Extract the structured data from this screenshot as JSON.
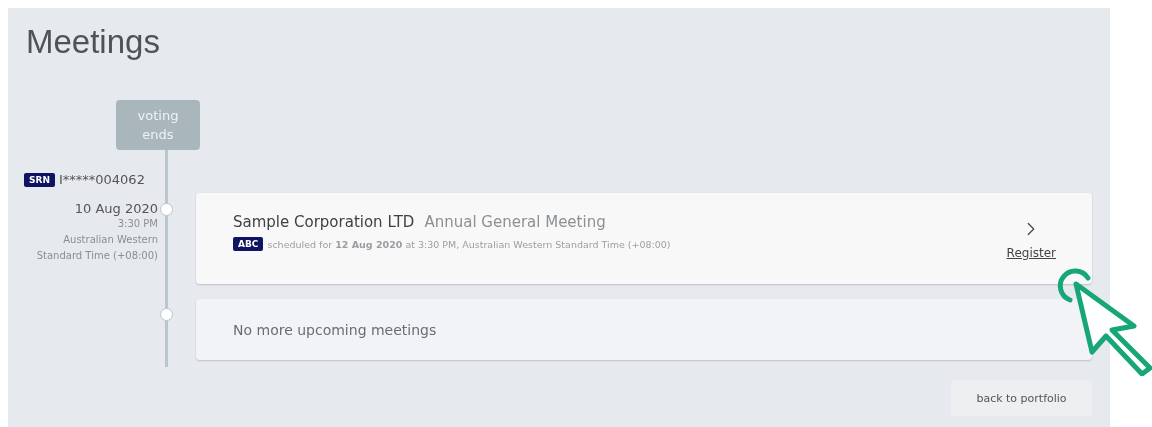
{
  "page": {
    "title": "Meetings"
  },
  "timeline": {
    "marker": "voting\nends",
    "account": {
      "badge": "SRN",
      "number": "I*****004062"
    },
    "meetings": [
      {
        "date": "10 Aug 2020",
        "time": "3:30 PM",
        "timezone": "Australian Western Standard Time (+08:00)",
        "company": "Sample Corporation LTD",
        "type": "Annual General Meeting",
        "code": "ABC",
        "schedule": "scheduled for **12 Aug 2020** at 3:30 PM, Australian Western Standard Time (+08:00)",
        "action": "Register"
      }
    ],
    "empty_message": "No more upcoming meetings"
  },
  "back_button": "back to portfolio"
}
